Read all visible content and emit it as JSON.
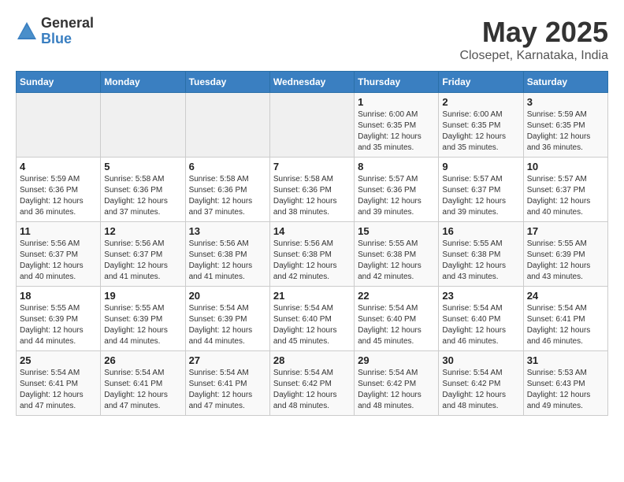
{
  "header": {
    "logo_general": "General",
    "logo_blue": "Blue",
    "title": "May 2025",
    "subtitle": "Closepet, Karnataka, India"
  },
  "weekdays": [
    "Sunday",
    "Monday",
    "Tuesday",
    "Wednesday",
    "Thursday",
    "Friday",
    "Saturday"
  ],
  "weeks": [
    [
      {
        "day": "",
        "detail": ""
      },
      {
        "day": "",
        "detail": ""
      },
      {
        "day": "",
        "detail": ""
      },
      {
        "day": "",
        "detail": ""
      },
      {
        "day": "1",
        "detail": "Sunrise: 6:00 AM\nSunset: 6:35 PM\nDaylight: 12 hours\nand 35 minutes."
      },
      {
        "day": "2",
        "detail": "Sunrise: 6:00 AM\nSunset: 6:35 PM\nDaylight: 12 hours\nand 35 minutes."
      },
      {
        "day": "3",
        "detail": "Sunrise: 5:59 AM\nSunset: 6:35 PM\nDaylight: 12 hours\nand 36 minutes."
      }
    ],
    [
      {
        "day": "4",
        "detail": "Sunrise: 5:59 AM\nSunset: 6:36 PM\nDaylight: 12 hours\nand 36 minutes."
      },
      {
        "day": "5",
        "detail": "Sunrise: 5:58 AM\nSunset: 6:36 PM\nDaylight: 12 hours\nand 37 minutes."
      },
      {
        "day": "6",
        "detail": "Sunrise: 5:58 AM\nSunset: 6:36 PM\nDaylight: 12 hours\nand 37 minutes."
      },
      {
        "day": "7",
        "detail": "Sunrise: 5:58 AM\nSunset: 6:36 PM\nDaylight: 12 hours\nand 38 minutes."
      },
      {
        "day": "8",
        "detail": "Sunrise: 5:57 AM\nSunset: 6:36 PM\nDaylight: 12 hours\nand 39 minutes."
      },
      {
        "day": "9",
        "detail": "Sunrise: 5:57 AM\nSunset: 6:37 PM\nDaylight: 12 hours\nand 39 minutes."
      },
      {
        "day": "10",
        "detail": "Sunrise: 5:57 AM\nSunset: 6:37 PM\nDaylight: 12 hours\nand 40 minutes."
      }
    ],
    [
      {
        "day": "11",
        "detail": "Sunrise: 5:56 AM\nSunset: 6:37 PM\nDaylight: 12 hours\nand 40 minutes."
      },
      {
        "day": "12",
        "detail": "Sunrise: 5:56 AM\nSunset: 6:37 PM\nDaylight: 12 hours\nand 41 minutes."
      },
      {
        "day": "13",
        "detail": "Sunrise: 5:56 AM\nSunset: 6:38 PM\nDaylight: 12 hours\nand 41 minutes."
      },
      {
        "day": "14",
        "detail": "Sunrise: 5:56 AM\nSunset: 6:38 PM\nDaylight: 12 hours\nand 42 minutes."
      },
      {
        "day": "15",
        "detail": "Sunrise: 5:55 AM\nSunset: 6:38 PM\nDaylight: 12 hours\nand 42 minutes."
      },
      {
        "day": "16",
        "detail": "Sunrise: 5:55 AM\nSunset: 6:38 PM\nDaylight: 12 hours\nand 43 minutes."
      },
      {
        "day": "17",
        "detail": "Sunrise: 5:55 AM\nSunset: 6:39 PM\nDaylight: 12 hours\nand 43 minutes."
      }
    ],
    [
      {
        "day": "18",
        "detail": "Sunrise: 5:55 AM\nSunset: 6:39 PM\nDaylight: 12 hours\nand 44 minutes."
      },
      {
        "day": "19",
        "detail": "Sunrise: 5:55 AM\nSunset: 6:39 PM\nDaylight: 12 hours\nand 44 minutes."
      },
      {
        "day": "20",
        "detail": "Sunrise: 5:54 AM\nSunset: 6:39 PM\nDaylight: 12 hours\nand 44 minutes."
      },
      {
        "day": "21",
        "detail": "Sunrise: 5:54 AM\nSunset: 6:40 PM\nDaylight: 12 hours\nand 45 minutes."
      },
      {
        "day": "22",
        "detail": "Sunrise: 5:54 AM\nSunset: 6:40 PM\nDaylight: 12 hours\nand 45 minutes."
      },
      {
        "day": "23",
        "detail": "Sunrise: 5:54 AM\nSunset: 6:40 PM\nDaylight: 12 hours\nand 46 minutes."
      },
      {
        "day": "24",
        "detail": "Sunrise: 5:54 AM\nSunset: 6:41 PM\nDaylight: 12 hours\nand 46 minutes."
      }
    ],
    [
      {
        "day": "25",
        "detail": "Sunrise: 5:54 AM\nSunset: 6:41 PM\nDaylight: 12 hours\nand 47 minutes."
      },
      {
        "day": "26",
        "detail": "Sunrise: 5:54 AM\nSunset: 6:41 PM\nDaylight: 12 hours\nand 47 minutes."
      },
      {
        "day": "27",
        "detail": "Sunrise: 5:54 AM\nSunset: 6:41 PM\nDaylight: 12 hours\nand 47 minutes."
      },
      {
        "day": "28",
        "detail": "Sunrise: 5:54 AM\nSunset: 6:42 PM\nDaylight: 12 hours\nand 48 minutes."
      },
      {
        "day": "29",
        "detail": "Sunrise: 5:54 AM\nSunset: 6:42 PM\nDaylight: 12 hours\nand 48 minutes."
      },
      {
        "day": "30",
        "detail": "Sunrise: 5:54 AM\nSunset: 6:42 PM\nDaylight: 12 hours\nand 48 minutes."
      },
      {
        "day": "31",
        "detail": "Sunrise: 5:53 AM\nSunset: 6:43 PM\nDaylight: 12 hours\nand 49 minutes."
      }
    ]
  ]
}
